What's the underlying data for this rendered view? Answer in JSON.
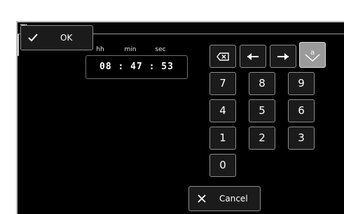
{
  "dialog": {
    "title": "Time"
  },
  "time": {
    "labels": {
      "hh": "hh",
      "min": "min",
      "sec": "sec"
    },
    "value": "08 : 47 : 53",
    "hours": "08",
    "minutes": "47",
    "seconds": "53"
  },
  "keypad": {
    "keys": [
      "7",
      "8",
      "9",
      "4",
      "5",
      "6",
      "1",
      "2",
      "3",
      "0"
    ],
    "tool_icons": [
      "backspace-icon",
      "arrow-left-icon",
      "arrow-right-icon",
      "case-toggle-icon"
    ],
    "case_icon_letter": "a"
  },
  "actions": {
    "cancel_label": "Cancel",
    "ok_label": "OK",
    "cancel_icon": "close-icon",
    "ok_icon": "checkmark-icon"
  },
  "colors": {
    "background": "#000000",
    "key_fill": "#1b1b1b",
    "key_border": "#8c8c8c",
    "active_key_fill": "#9a9a9a",
    "text": "#ffffff"
  }
}
